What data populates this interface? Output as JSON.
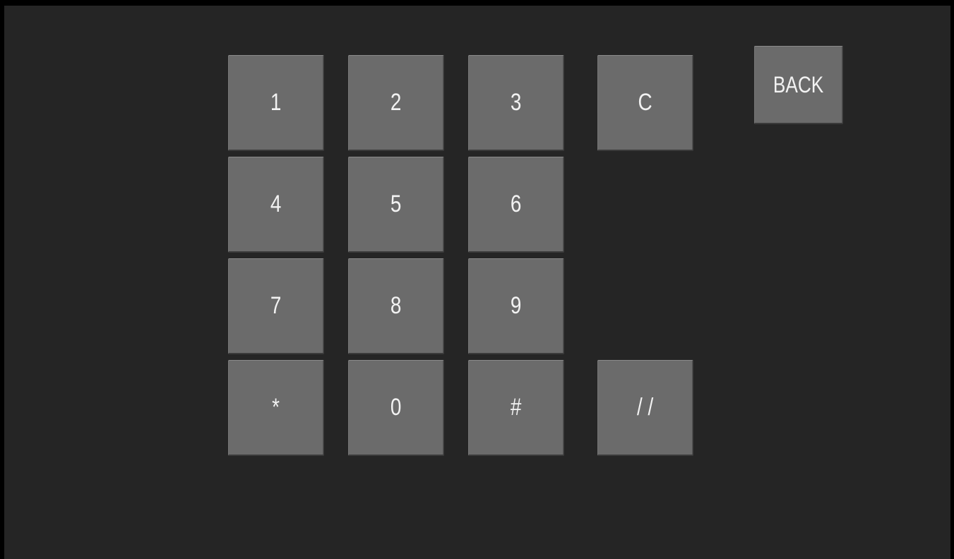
{
  "keypad": {
    "keys": {
      "k1": "1",
      "k2": "2",
      "k3": "3",
      "clear": "C",
      "k4": "4",
      "k5": "5",
      "k6": "6",
      "k7": "7",
      "k8": "8",
      "k9": "9",
      "star": "*",
      "k0": "0",
      "hash": "#",
      "slash": "/ /"
    },
    "back_label": "BACK"
  },
  "colors": {
    "background": "#252525",
    "key_face": "#6b6b6b",
    "key_text": "#f2f2f2"
  }
}
